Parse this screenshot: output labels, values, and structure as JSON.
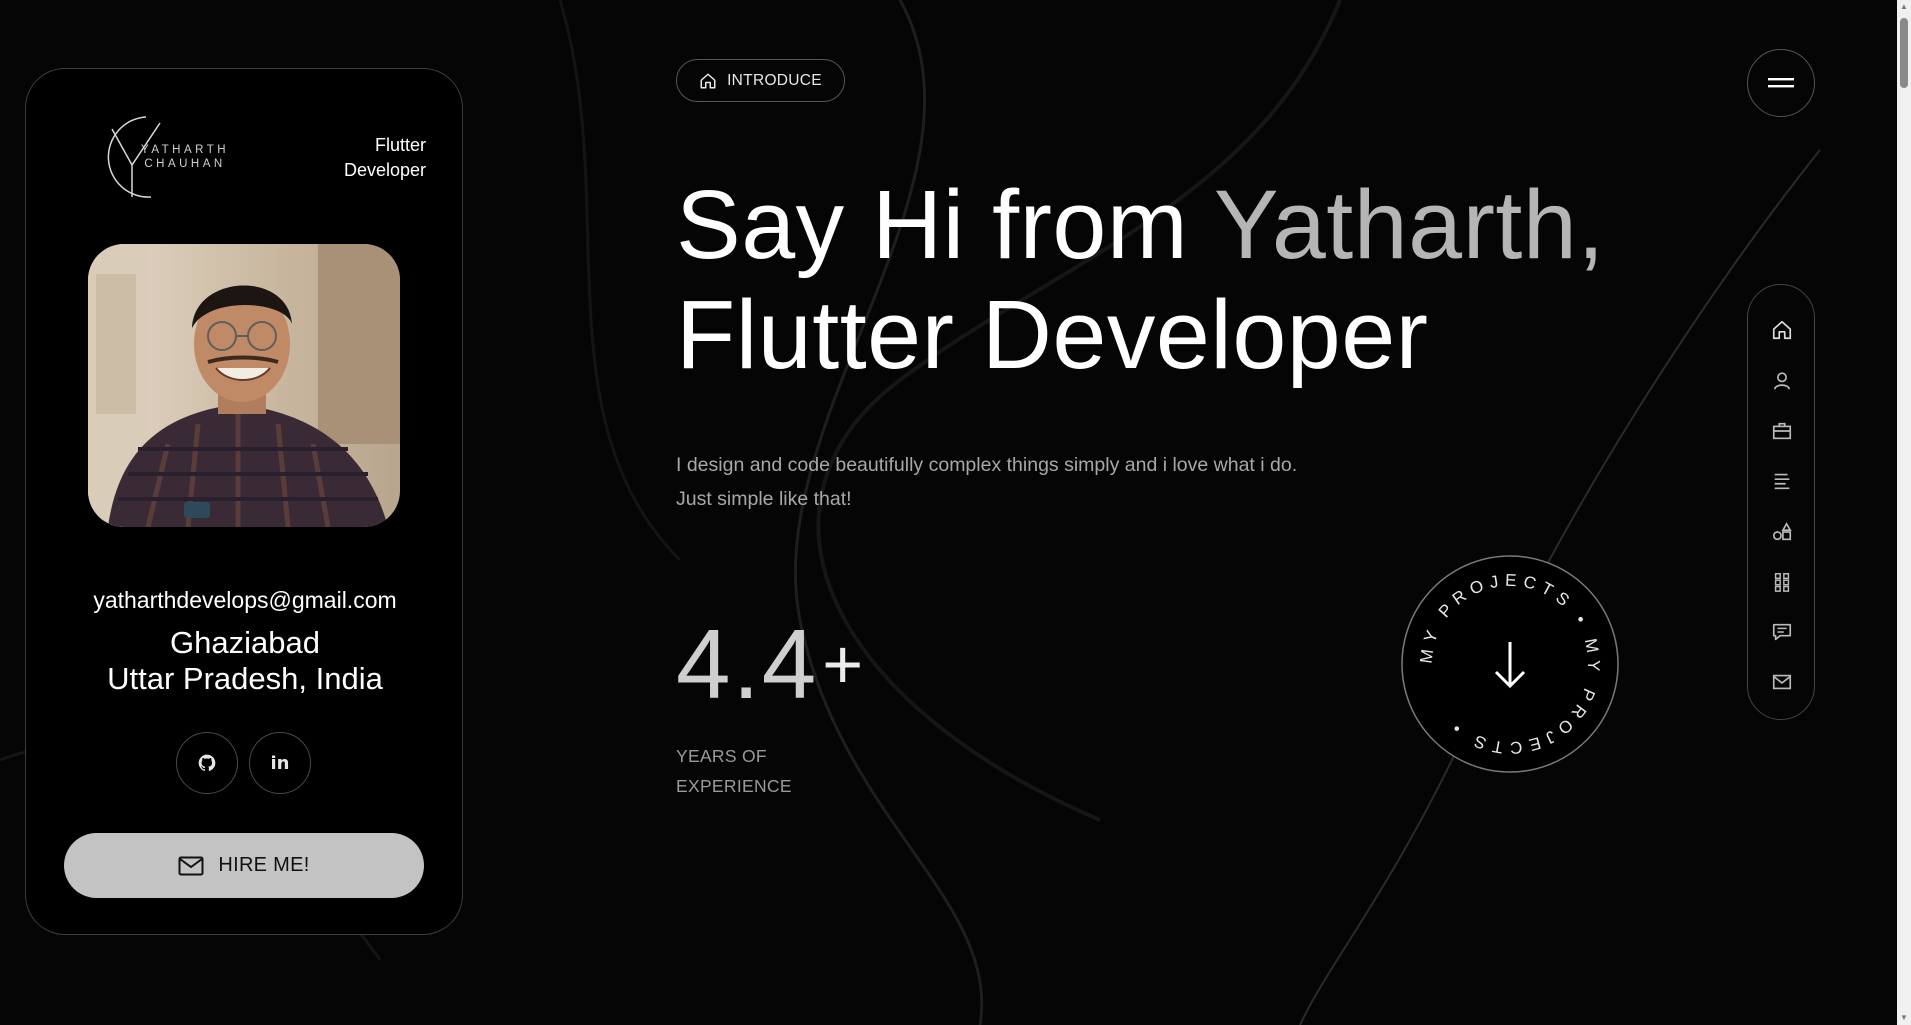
{
  "brand": {
    "logo_line1": "YATHARTH",
    "logo_line2": "CHAUHAN"
  },
  "profile": {
    "role_line1": "Flutter",
    "role_line2": "Developer",
    "email": "yatharthdevelops@gmail.com",
    "city": "Ghaziabad",
    "state": "Uttar Pradesh, India",
    "social": [
      {
        "name": "github",
        "icon": "github-icon"
      },
      {
        "name": "linkedin",
        "icon": "linkedin-icon",
        "label": "in"
      }
    ],
    "hire_label": "HIRE ME!"
  },
  "intro": {
    "pill_label": "INTRODUCE",
    "headline_part1": "Say Hi from ",
    "headline_name": "Yatharth,",
    "headline_line2": "Flutter Developer",
    "description": "I design and code beautifully complex things simply and i love what i do. Just simple like that!",
    "stat_value": "4.4",
    "stat_suffix": "+",
    "stat_label_line1": "YEARS OF",
    "stat_label_line2": "EXPERIENCE",
    "badge_text": "MY PROJECTS • MY PROJECTS •"
  },
  "nav": {
    "menu_icon": "hamburger-icon",
    "items": [
      {
        "name": "home",
        "icon": "home-icon"
      },
      {
        "name": "about",
        "icon": "user-icon"
      },
      {
        "name": "resume",
        "icon": "briefcase-icon"
      },
      {
        "name": "services",
        "icon": "align-icon"
      },
      {
        "name": "skills",
        "icon": "shapes-icon"
      },
      {
        "name": "portfolio",
        "icon": "grid-icon"
      },
      {
        "name": "testimonials",
        "icon": "comment-icon"
      },
      {
        "name": "contact",
        "icon": "mail-icon"
      }
    ]
  },
  "colors": {
    "background": "#000000",
    "accent_name": "#b5b5b5",
    "hire_button": "#c3c3c3",
    "border": "#3d3d3d"
  }
}
